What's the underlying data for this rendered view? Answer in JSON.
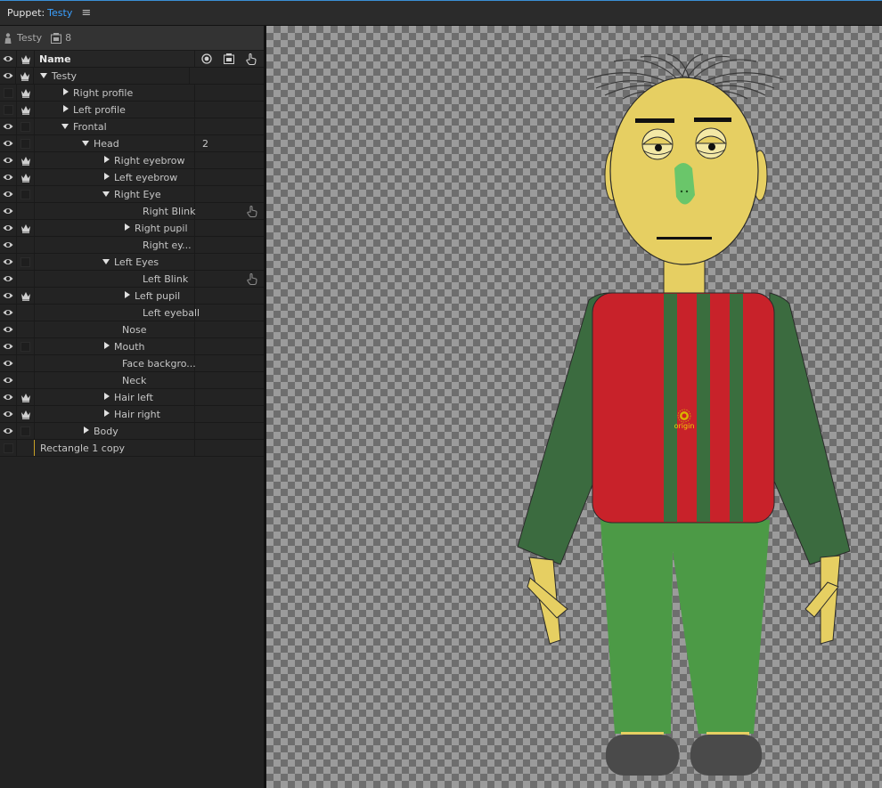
{
  "titlebar": {
    "label": "Puppet:",
    "puppet_name": "Testy",
    "menu_icon": "hamburger-icon"
  },
  "subheader": {
    "puppet_name": "Testy",
    "count": "8"
  },
  "columns": {
    "name": "Name"
  },
  "layers": [
    {
      "name": "Testy",
      "depth": 0,
      "expand": "down",
      "eye": true,
      "crown": true,
      "sq": false,
      "tag": "",
      "trig": "",
      "indicator": "scene"
    },
    {
      "name": "Right profile",
      "depth": 1,
      "expand": "right",
      "eye": false,
      "crown": true,
      "sq": false,
      "tag": "",
      "trig": ""
    },
    {
      "name": "Left profile",
      "depth": 1,
      "expand": "right",
      "eye": false,
      "crown": true,
      "sq": false,
      "tag": "",
      "trig": ""
    },
    {
      "name": "Frontal",
      "depth": 1,
      "expand": "down",
      "eye": true,
      "crown": false,
      "sq": true,
      "tag": "",
      "trig": ""
    },
    {
      "name": "Head",
      "depth": 2,
      "expand": "down",
      "eye": true,
      "crown": false,
      "sq": true,
      "tag": "2",
      "trig": ""
    },
    {
      "name": "Right eyebrow",
      "depth": 3,
      "expand": "right",
      "eye": true,
      "crown": true,
      "sq": false,
      "tag": "",
      "trig": ""
    },
    {
      "name": "Left eyebrow",
      "depth": 3,
      "expand": "right",
      "eye": true,
      "crown": true,
      "sq": false,
      "tag": "",
      "trig": ""
    },
    {
      "name": "Right Eye",
      "depth": 3,
      "expand": "down",
      "eye": true,
      "crown": false,
      "sq": true,
      "tag": "",
      "trig": ""
    },
    {
      "name": "Right Blink",
      "depth": 5,
      "expand": "none",
      "eye": true,
      "crown": false,
      "sq": false,
      "tag": "",
      "trig": "hand"
    },
    {
      "name": "Right pupil",
      "depth": 4,
      "expand": "right",
      "eye": true,
      "crown": true,
      "sq": false,
      "tag": "",
      "trig": ""
    },
    {
      "name": "Right ey...",
      "depth": 5,
      "expand": "none",
      "eye": true,
      "crown": false,
      "sq": false,
      "tag": "",
      "trig": ""
    },
    {
      "name": "Left Eyes",
      "depth": 3,
      "expand": "down",
      "eye": true,
      "crown": false,
      "sq": true,
      "tag": "",
      "trig": ""
    },
    {
      "name": "Left Blink",
      "depth": 5,
      "expand": "none",
      "eye": true,
      "crown": false,
      "sq": false,
      "tag": "",
      "trig": "hand"
    },
    {
      "name": "Left pupil",
      "depth": 4,
      "expand": "right",
      "eye": true,
      "crown": true,
      "sq": false,
      "tag": "",
      "trig": ""
    },
    {
      "name": "Left eyeball",
      "depth": 5,
      "expand": "none",
      "eye": true,
      "crown": false,
      "sq": false,
      "tag": "",
      "trig": ""
    },
    {
      "name": "Nose",
      "depth": 4,
      "expand": "none",
      "eye": true,
      "crown": false,
      "sq": false,
      "tag": "",
      "trig": ""
    },
    {
      "name": "Mouth",
      "depth": 3,
      "expand": "right",
      "eye": true,
      "crown": false,
      "sq": true,
      "tag": "",
      "trig": ""
    },
    {
      "name": "Face backgro...",
      "depth": 4,
      "expand": "none",
      "eye": true,
      "crown": false,
      "sq": false,
      "tag": "",
      "trig": ""
    },
    {
      "name": "Neck",
      "depth": 4,
      "expand": "none",
      "eye": true,
      "crown": false,
      "sq": false,
      "tag": "",
      "trig": ""
    },
    {
      "name": "Hair left",
      "depth": 3,
      "expand": "right",
      "eye": true,
      "crown": true,
      "sq": false,
      "tag": "",
      "trig": ""
    },
    {
      "name": "Hair right",
      "depth": 3,
      "expand": "right",
      "eye": true,
      "crown": true,
      "sq": false,
      "tag": "",
      "trig": ""
    },
    {
      "name": "Body",
      "depth": 2,
      "expand": "right",
      "eye": true,
      "crown": false,
      "sq": true,
      "tag": "",
      "trig": ""
    },
    {
      "name": "Rectangle 1 copy",
      "depth": 0,
      "expand": "none",
      "eye": false,
      "crown": false,
      "sq": false,
      "tag": "",
      "trig": "",
      "yellowbar": true
    }
  ],
  "stage": {
    "origin_label": "origin"
  },
  "colors": {
    "accent": "#3aa0ff",
    "skin": "#e6cf62",
    "shirt_red": "#c8222a",
    "shirt_stripe": "#3a6e3e",
    "sleeve": "#3b6b3f",
    "pants": "#4c9a46",
    "shoe": "#4a4a4a",
    "nose": "#6ac66a"
  }
}
